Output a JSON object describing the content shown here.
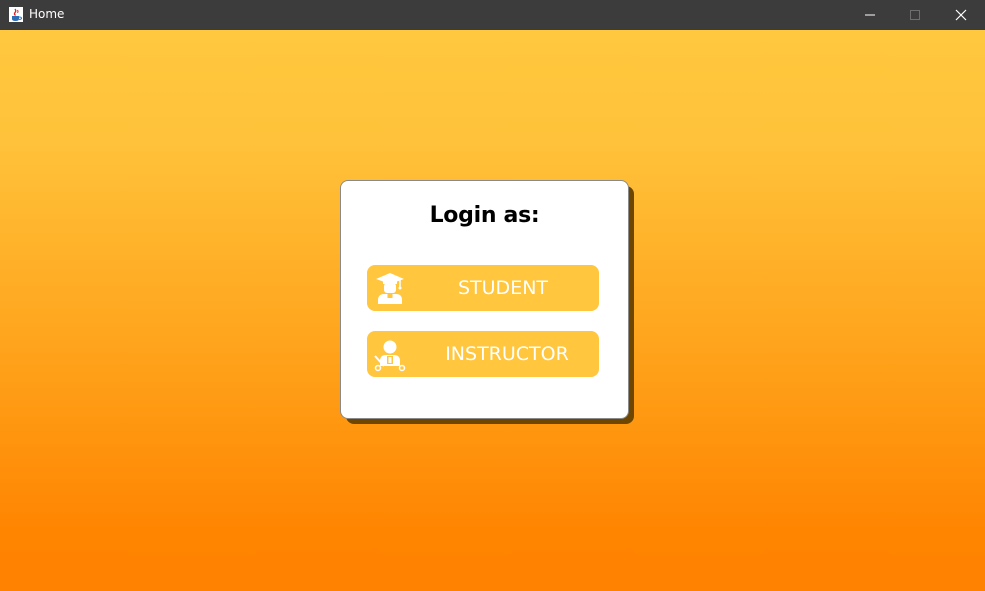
{
  "window": {
    "title": "Home",
    "app_icon": "java-cup-icon",
    "controls": [
      "minimize-icon",
      "maximize-icon",
      "close-icon"
    ]
  },
  "colors": {
    "titlebar": "#3c3c3c",
    "gradient_top": "#ffc83e",
    "gradient_bottom": "#ff8200",
    "card": "#ffffff",
    "button": "#ffc63e",
    "button_text": "#ffffff"
  },
  "login": {
    "heading": "Login as:",
    "options": [
      {
        "label": "STUDENT",
        "icon": "graduate-icon"
      },
      {
        "label": "INSTRUCTOR",
        "icon": "teacher-icon"
      }
    ]
  }
}
